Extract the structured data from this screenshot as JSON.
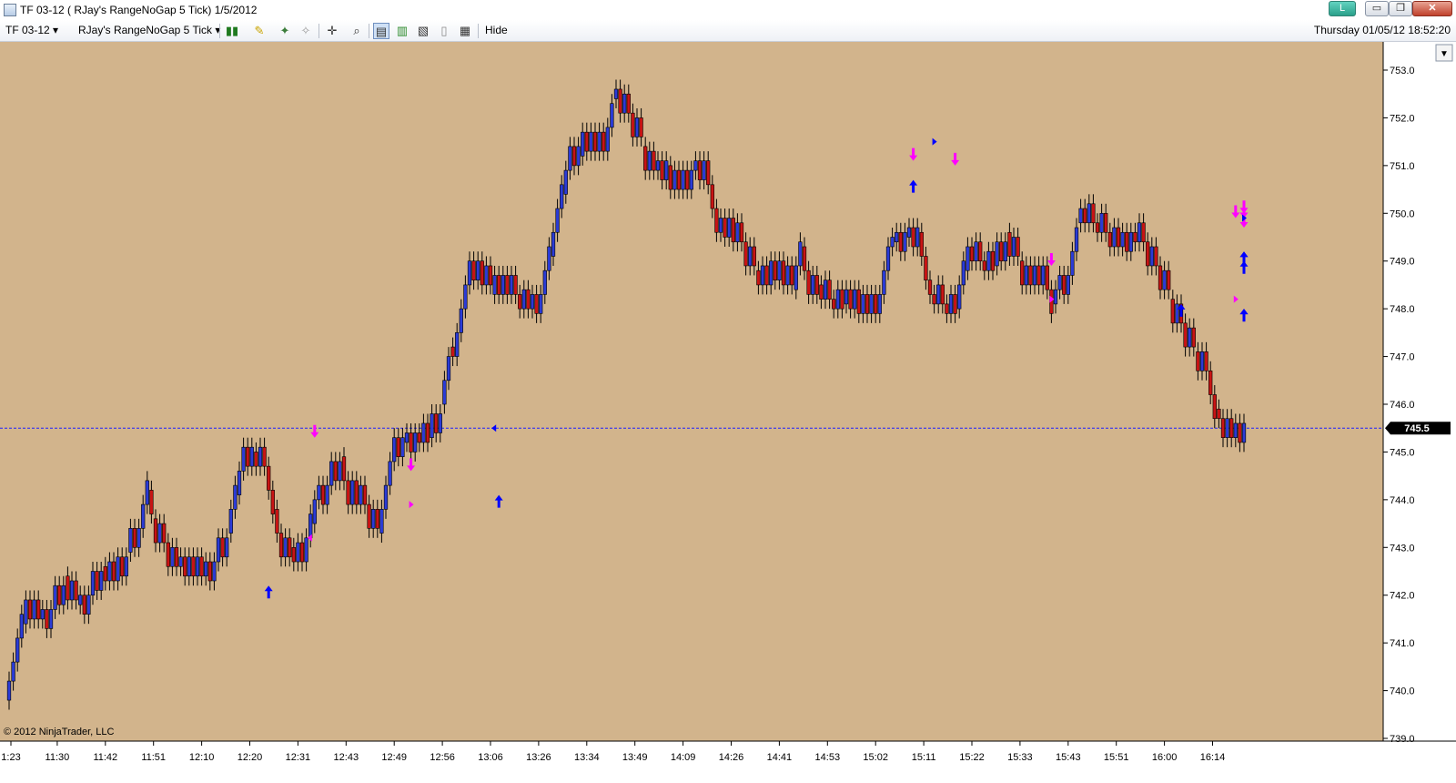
{
  "window": {
    "title": "TF 03-12 ( RJay's RangeNoGap  5 Tick)  1/5/2012",
    "buttons": {
      "l": "L",
      "minimize": "▭",
      "maximize": "❐",
      "close": "✕"
    }
  },
  "toolbar": {
    "instrument": "TF 03-12",
    "period": "RJay's RangeNoGap  5 Tick",
    "hide_label": "Hide",
    "datetime": "Thursday 01/05/12 18:52:20",
    "icons": [
      "bar-type-icon",
      "drawing-tool-icon",
      "indicator-icon",
      "strategy-icon",
      "crosshair-icon",
      "zoom-icon",
      "data-box-icon",
      "chart-trader-icon",
      "properties-icon",
      "print-icon",
      "order-icon"
    ]
  },
  "chart": {
    "colors": {
      "background": "#D2B48C",
      "up_candle": "#2B3BD6",
      "down_candle": "#C81414",
      "wick": "#000000",
      "marker_magenta": "#FF00FF",
      "marker_blue": "#0000FF",
      "hline": "#1E1EFF",
      "price_box": "#000000"
    },
    "copyright": "© 2012 NinjaTrader, LLC",
    "current_price_label": "745.5",
    "current_price": 745.5,
    "y_axis_ticks": [
      "739.0",
      "740.0",
      "741.0",
      "742.0",
      "743.0",
      "744.0",
      "745.0",
      "746.0",
      "747.0",
      "748.0",
      "749.0",
      "750.0",
      "751.0",
      "752.0",
      "753.0"
    ],
    "x_axis_ticks": [
      "1:23",
      "11:30",
      "11:42",
      "11:51",
      "12:10",
      "12:20",
      "12:31",
      "12:43",
      "12:49",
      "12:56",
      "13:06",
      "13:26",
      "13:34",
      "13:49",
      "14:09",
      "14:26",
      "14:41",
      "14:53",
      "15:02",
      "15:11",
      "15:22",
      "15:33",
      "15:43",
      "15:51",
      "16:00",
      "16:14"
    ],
    "close_path": [
      739.8,
      740.2,
      740.6,
      741.4,
      741.9,
      741.5,
      741.7,
      742.4,
      741.8,
      742.0,
      742.6,
      742.3,
      742.9,
      743.4,
      744.2,
      743.6,
      743.1,
      742.6,
      742.8,
      742.4,
      742.7,
      743.3,
      744.1,
      745.0,
      744.7,
      743.8,
      743.0,
      742.7,
      743.5,
      744.0,
      744.3,
      744.9,
      743.9,
      744.4,
      743.9,
      743.3,
      744.3,
      745.2,
      745.4,
      745.3,
      746.0,
      747.2,
      747.0,
      748.0,
      749.0,
      748.3,
      748.7,
      748.3,
      748.0,
      748.3,
      749.1,
      750.4,
      751.2,
      751.7,
      751.3,
      752.4,
      752.6,
      752.1,
      751.4,
      750.9,
      751.0,
      750.5,
      750.9,
      751.1,
      750.1,
      749.6,
      749.9,
      749.4,
      748.8,
      748.5,
      749.0,
      748.4,
      749.3,
      748.5,
      748.2,
      748.1,
      748.4,
      747.9,
      748.3,
      749.3,
      749.4,
      749.5,
      749.6,
      748.6,
      748.3,
      748.1,
      748.0,
      748.8,
      749.3,
      749.0,
      748.9,
      749.6,
      749.0,
      748.5,
      748.9,
      748.1,
      748.4,
      748.7,
      749.8,
      750.1,
      749.8,
      749.6,
      749.3,
      749.6,
      749.4,
      748.9,
      748.2,
      747.7,
      747.1,
      746.7,
      745.9,
      745.7,
      745.3,
      745.6
    ],
    "markers": [
      {
        "type": "arrow-down",
        "color": "magenta",
        "bar": 28,
        "price": 745.3
      },
      {
        "type": "triangle-left",
        "color": "magenta",
        "bar": 28,
        "price": 743.2
      },
      {
        "type": "arrow-up",
        "color": "blue",
        "bar": 24,
        "price": 742.2
      },
      {
        "type": "arrow-down",
        "color": "magenta",
        "bar": 37,
        "price": 744.6
      },
      {
        "type": "triangle-right",
        "color": "magenta",
        "bar": 37,
        "price": 743.9
      },
      {
        "type": "arrow-up",
        "color": "blue",
        "bar": 45,
        "price": 744.1
      },
      {
        "type": "triangle-left",
        "color": "blue",
        "bar": 45,
        "price": 745.5
      },
      {
        "type": "arrow-down",
        "color": "magenta",
        "bar": 83,
        "price": 751.1
      },
      {
        "type": "arrow-up",
        "color": "blue",
        "bar": 83,
        "price": 750.7
      },
      {
        "type": "arrow-down",
        "color": "magenta",
        "bar": 87,
        "price": 751.0
      },
      {
        "type": "triangle-right",
        "color": "blue",
        "bar": 85,
        "price": 751.5
      },
      {
        "type": "arrow-down",
        "color": "magenta",
        "bar": 96,
        "price": 748.9
      },
      {
        "type": "triangle-right",
        "color": "magenta",
        "bar": 96,
        "price": 748.2
      },
      {
        "type": "arrow-up",
        "color": "blue",
        "bar": 108,
        "price": 748.1
      },
      {
        "type": "triangle-right",
        "color": "magenta",
        "bar": 113,
        "price": 748.2
      },
      {
        "type": "arrow-down",
        "color": "magenta",
        "bar": 113,
        "price": 749.9
      },
      {
        "type": "arrow-up",
        "color": "blue",
        "bar": 118,
        "price": 748.0
      },
      {
        "type": "arrow-up",
        "color": "blue",
        "bar": 130,
        "price": 748.0
      },
      {
        "type": "arrow-up",
        "color": "blue",
        "bar": 132,
        "price": 749.2
      },
      {
        "type": "arrow-down",
        "color": "magenta",
        "bar": 135,
        "price": 750.0
      },
      {
        "type": "arrow-down",
        "color": "magenta",
        "bar": 138,
        "price": 749.9
      },
      {
        "type": "arrow-up",
        "color": "blue",
        "bar": 136,
        "price": 749.0
      },
      {
        "type": "arrow-up",
        "color": "blue",
        "bar": 140,
        "price": 749.2
      },
      {
        "type": "arrow-down",
        "color": "magenta",
        "bar": 141,
        "price": 749.7
      },
      {
        "type": "triangle-right",
        "color": "blue",
        "bar": 140,
        "price": 749.9
      }
    ]
  }
}
